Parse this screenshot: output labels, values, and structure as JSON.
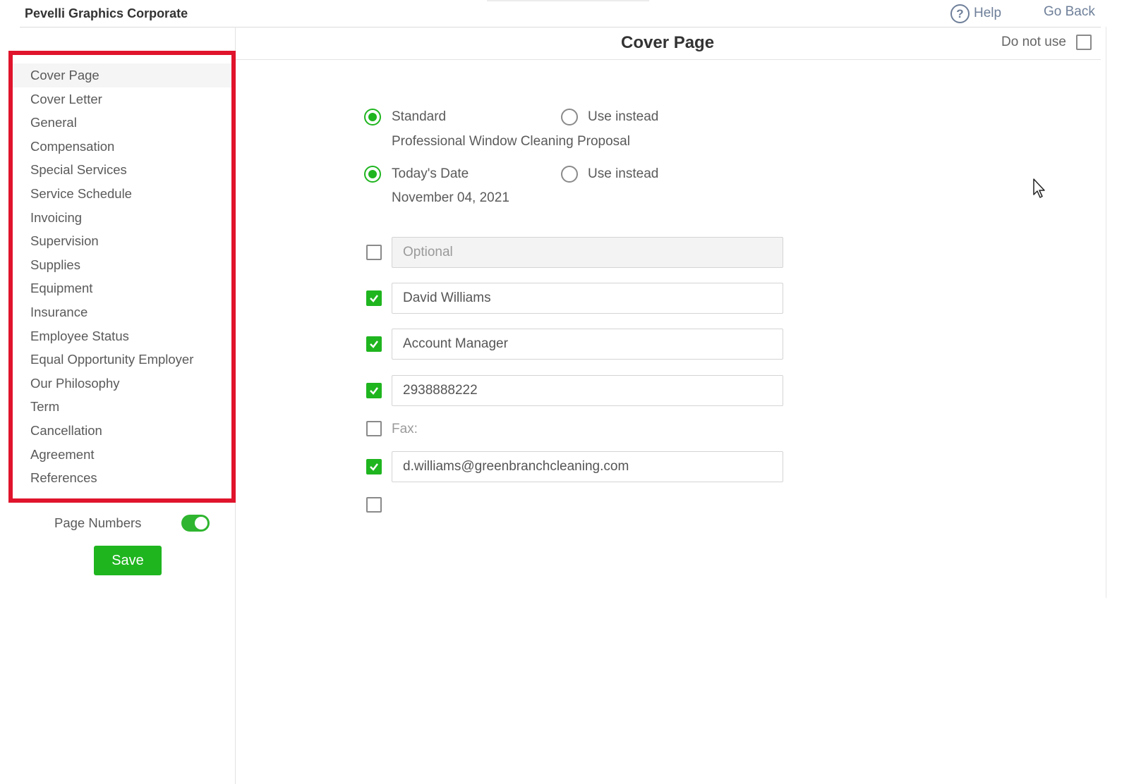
{
  "app": {
    "title": "Pevelli Graphics Corporate",
    "help_label": "Help",
    "go_back_label": "Go Back"
  },
  "sidebar": {
    "items": [
      {
        "label": "Cover Page",
        "active": true
      },
      {
        "label": "Cover Letter"
      },
      {
        "label": "General"
      },
      {
        "label": "Compensation"
      },
      {
        "label": "Special Services"
      },
      {
        "label": "Service Schedule"
      },
      {
        "label": "Invoicing"
      },
      {
        "label": "Supervision"
      },
      {
        "label": "Supplies"
      },
      {
        "label": "Equipment"
      },
      {
        "label": "Insurance"
      },
      {
        "label": "Employee Status"
      },
      {
        "label": "Equal Opportunity Employer"
      },
      {
        "label": "Our Philosophy"
      },
      {
        "label": "Term"
      },
      {
        "label": "Cancellation"
      },
      {
        "label": "Agreement"
      },
      {
        "label": "References"
      }
    ],
    "page_numbers_label": "Page Numbers",
    "page_numbers_on": true,
    "save_label": "Save"
  },
  "main": {
    "title": "Cover Page",
    "do_not_use_label": "Do not use",
    "title_option": {
      "standard_label": "Standard",
      "use_instead_label": "Use instead",
      "standard_text": "Professional Window Cleaning Proposal",
      "selected": "standard"
    },
    "date_option": {
      "today_label": "Today's Date",
      "use_instead_label": "Use instead",
      "date_text": "November 04, 2021",
      "selected": "today"
    },
    "fields": {
      "optional_placeholder": "Optional",
      "name_value": "David Williams",
      "position_value": "Account Manager",
      "phone_value": "2938888222",
      "fax_label": "Fax:",
      "email_value": "d.williams@greenbranchcleaning.com"
    }
  },
  "colors": {
    "accent_green": "#1fb51f",
    "highlight_red": "#e0142c",
    "link_blue_gray": "#6e7f99"
  }
}
